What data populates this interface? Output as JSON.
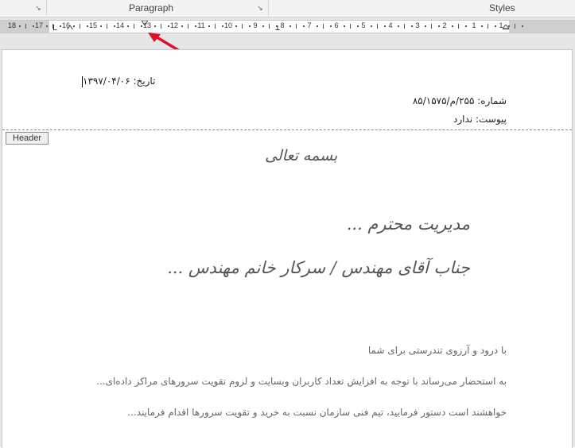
{
  "ribbon": {
    "groups": [
      {
        "label": "Paragraph"
      },
      {
        "label": "Styles"
      }
    ],
    "launcher_glyph": "↘"
  },
  "ruler": {
    "numbers": [
      "18",
      "17",
      "16",
      "15",
      "14",
      "13",
      "12",
      "11",
      "10",
      "9",
      "8",
      "7",
      "6",
      "5",
      "4",
      "3",
      "2",
      "1",
      "1"
    ]
  },
  "document": {
    "date_line": "تاریخ: ۱۳۹۷/۰۴/۰۶",
    "number_line": "شماره: ۲۵۵/م/۸۵/۱۵۷۵",
    "attachment_line": "پیوست: ندارد",
    "header_label": "Header",
    "salutation": "بسمه تعالی",
    "addressee_1": "مدیریت محترم ...",
    "addressee_2": "جناب آقای مهندس / سرکار خانم مهندس ...",
    "para_1": "با درود و آرزوی تندرستی برای شما",
    "para_2": "به استحضار می‌رساند با توجه به افزایش تعداد کاربران وبسایت و لزوم تقویت سرورهای مراکز داده‌ای...",
    "para_3": "خواهشند است دستور فرمایید، تیم فنی سازمان نسبت به خرید و تقویت سرورها اقدام فرمایند..."
  },
  "colors": {
    "annotation_arrow": "#e0102a"
  }
}
